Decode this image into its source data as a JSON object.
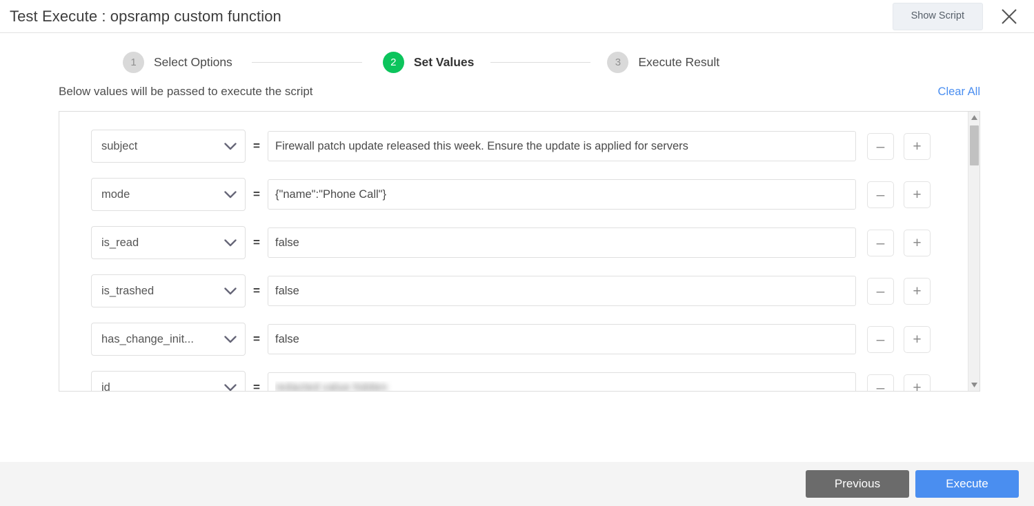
{
  "header": {
    "title": "Test Execute : opsramp custom function",
    "show_script_label": "Show Script",
    "close_label": "Close"
  },
  "stepper": {
    "steps": [
      {
        "number": "1",
        "label": "Select Options",
        "state": "inactive"
      },
      {
        "number": "2",
        "label": "Set Values",
        "state": "active"
      },
      {
        "number": "3",
        "label": "Execute Result",
        "state": "inactive"
      }
    ]
  },
  "subheader": {
    "description": "Below values will be passed to execute the script",
    "clear_all_label": "Clear All"
  },
  "values": {
    "rows": [
      {
        "key": "subject",
        "value": "Firewall patch update released this week. Ensure the update is applied for servers",
        "remove_label": "–",
        "add_label": "+"
      },
      {
        "key": "mode",
        "value": "{\"name\":\"Phone Call\"}",
        "remove_label": "–",
        "add_label": "+"
      },
      {
        "key": "is_read",
        "value": "false",
        "remove_label": "–",
        "add_label": "+"
      },
      {
        "key": "is_trashed",
        "value": "false",
        "remove_label": "–",
        "add_label": "+"
      },
      {
        "key": "has_change_init...",
        "value": "false",
        "remove_label": "–",
        "add_label": "+"
      },
      {
        "key": "id",
        "value": "redacted value hidden",
        "redacted": true,
        "remove_label": "–",
        "add_label": "+"
      }
    ]
  },
  "footer": {
    "previous_label": "Previous",
    "execute_label": "Execute"
  },
  "colors": {
    "accent_green": "#0cc45c",
    "accent_blue": "#4a8ef0",
    "previous_gray": "#6b6b6b",
    "footer_bg": "#f4f4f4",
    "border": "#dcdcdc"
  }
}
